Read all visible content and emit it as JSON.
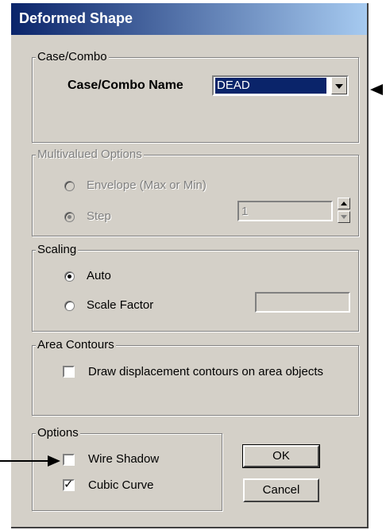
{
  "window": {
    "title": "Deformed Shape"
  },
  "case_combo": {
    "legend": "Case/Combo",
    "name_label": "Case/Combo Name",
    "selected": "DEAD"
  },
  "multivalued": {
    "legend": "Multivalued Options",
    "envelope_label": "Envelope (Max or Min)",
    "step_label": "Step",
    "step_value": "1"
  },
  "scaling": {
    "legend": "Scaling",
    "auto_label": "Auto",
    "scale_factor_label": "Scale Factor",
    "scale_factor_value": ""
  },
  "area_contours": {
    "legend": "Area Contours",
    "draw_label": "Draw displacement contours on area objects"
  },
  "options": {
    "legend": "Options",
    "wire_shadow_label": "Wire Shadow",
    "cubic_curve_label": "Cubic Curve"
  },
  "buttons": {
    "ok": "OK",
    "cancel": "Cancel"
  }
}
